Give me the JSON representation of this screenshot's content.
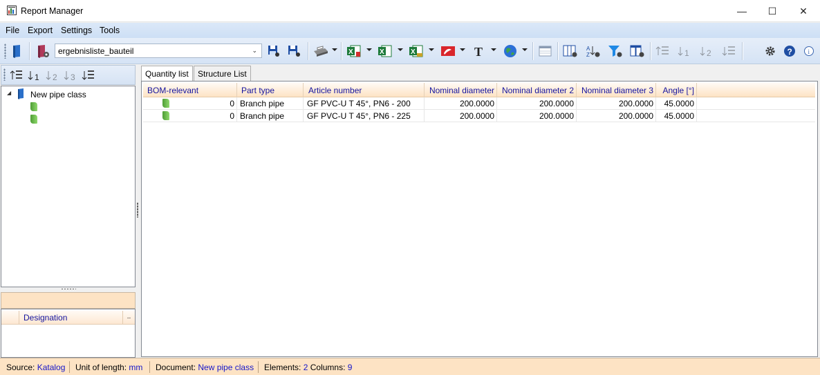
{
  "window": {
    "title": "Report Manager",
    "minimize": "—",
    "maximize": "☐",
    "close": "✕"
  },
  "menu": [
    {
      "label": "File"
    },
    {
      "label": "Export"
    },
    {
      "label": "Settings"
    },
    {
      "label": "Tools"
    }
  ],
  "toolbar": {
    "report_combo_value": "ergebnisliste_bauteil",
    "icons": [
      "open-report-icon",
      "report-settings-icon",
      "save-icon",
      "save-as-icon",
      "print-icon",
      "excel-export-icon",
      "excel-icon",
      "excel-template-icon",
      "pdf-export-icon",
      "text-icon",
      "web-export-icon",
      "table-layout-icon",
      "columns-icon",
      "sort-icon",
      "filter-icon",
      "group-icon",
      "sort-asc-icon",
      "sort-1-icon",
      "sort-2-icon",
      "sort-desc-icon",
      "settings-icon",
      "help-icon",
      "info-icon"
    ]
  },
  "tree": {
    "root_label": "New pipe class",
    "children_count": 2
  },
  "properties": {
    "column_header": "Designation",
    "column_more": ".."
  },
  "tabs": [
    {
      "label": "Quantity list",
      "active": true
    },
    {
      "label": "Structure List",
      "active": false
    }
  ],
  "grid": {
    "columns": [
      "BOM-relevant",
      "Part type",
      "Article number",
      "Nominal diameter",
      "Nominal diameter 2",
      "Nominal diameter 3",
      "Angle [°]"
    ],
    "rows": [
      {
        "bom": "0",
        "part_type": "Branch pipe",
        "article": "GF PVC-U T 45°, PN6 - 200",
        "dn1": "200.0000",
        "dn2": "200.0000",
        "dn3": "200.0000",
        "angle": "45.0000"
      },
      {
        "bom": "0",
        "part_type": "Branch pipe",
        "article": "GF PVC-U T 45°, PN6 - 225",
        "dn1": "200.0000",
        "dn2": "200.0000",
        "dn3": "200.0000",
        "angle": "45.0000"
      }
    ]
  },
  "status": {
    "source_label": "Source:",
    "source_value": "Katalog",
    "unit_label": "Unit of length:",
    "unit_value": "mm",
    "document_label": "Document:",
    "document_value": "New pipe class",
    "elements_label": "Elements:",
    "elements_value": "2",
    "columns_label": "Columns:",
    "columns_value": "9"
  },
  "colors": {
    "header_text": "#14139e",
    "status_value": "#1515c9",
    "status_bg": "#fde3c4"
  }
}
